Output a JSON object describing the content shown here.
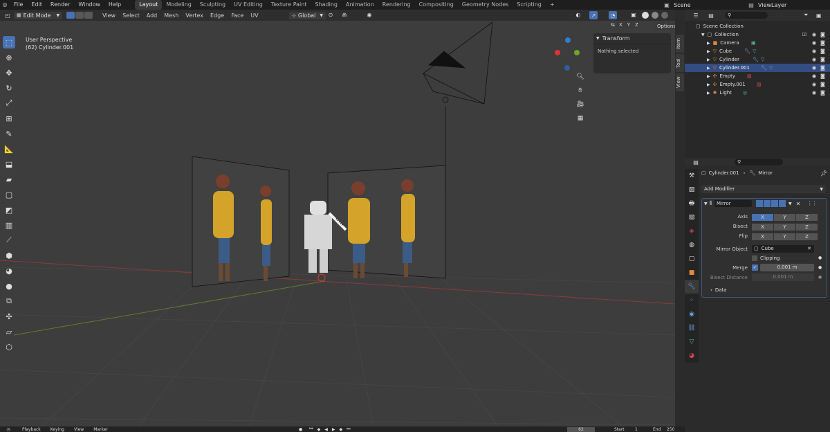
{
  "topbar": {
    "menus": [
      "File",
      "Edit",
      "Render",
      "Window",
      "Help"
    ],
    "workspaces": [
      "Layout",
      "Modeling",
      "Sculpting",
      "UV Editing",
      "Texture Paint",
      "Shading",
      "Animation",
      "Rendering",
      "Compositing",
      "Geometry Nodes",
      "Scripting"
    ],
    "active_workspace": "Layout",
    "scene": "Scene",
    "view_layer": "ViewLayer"
  },
  "viewport": {
    "mode": "Edit Mode",
    "menus": [
      "View",
      "Select",
      "Add",
      "Mesh",
      "Vertex",
      "Edge",
      "Face",
      "UV"
    ],
    "orientation": "Global",
    "options_label": "Options",
    "xyz": [
      "X",
      "Y",
      "Z"
    ],
    "perspective": "User Perspective",
    "object_info": "(62) Cylinder.001",
    "colors": {
      "bg": "#3d3d3d",
      "grid": "#474747",
      "x_axis": "#8b3a3a",
      "y_axis": "#5f7d2f",
      "accent": "#4772b3"
    }
  },
  "npanel": {
    "title": "Transform",
    "body": "Nothing selected",
    "tabs": [
      "Item",
      "Tool",
      "View"
    ]
  },
  "timeline": {
    "menus": [
      "Playback",
      "Keying",
      "View",
      "Marker"
    ],
    "current_frame": "62",
    "start_label": "Start",
    "start": "1",
    "end_label": "End",
    "end": "250"
  },
  "outliner": {
    "scene_collection": "Scene Collection",
    "collection": "Collection",
    "items": [
      {
        "name": "Camera",
        "selected": false
      },
      {
        "name": "Cube",
        "selected": false
      },
      {
        "name": "Cylinder",
        "selected": false
      },
      {
        "name": "Cylinder.001",
        "selected": true
      },
      {
        "name": "Empty",
        "selected": false
      },
      {
        "name": "Empty.001",
        "selected": false
      },
      {
        "name": "Light",
        "selected": false
      }
    ]
  },
  "properties": {
    "breadcrumb_object": "Cylinder.001",
    "breadcrumb_modifier": "Mirror",
    "add_modifier": "Add Modifier",
    "modifier_name": "Mirror",
    "labels": {
      "axis": "Axis",
      "bisect": "Bisect",
      "flip": "Flip",
      "mirror_object": "Mirror Object",
      "clipping": "Clipping",
      "merge": "Merge",
      "bisect_distance": "Bisect Distance",
      "data": "Data"
    },
    "axis_buttons": [
      "X",
      "Y",
      "Z"
    ],
    "mirror_object_value": "Cube",
    "merge_value": "0.001 m",
    "bisect_distance_value": "0.001 m"
  }
}
